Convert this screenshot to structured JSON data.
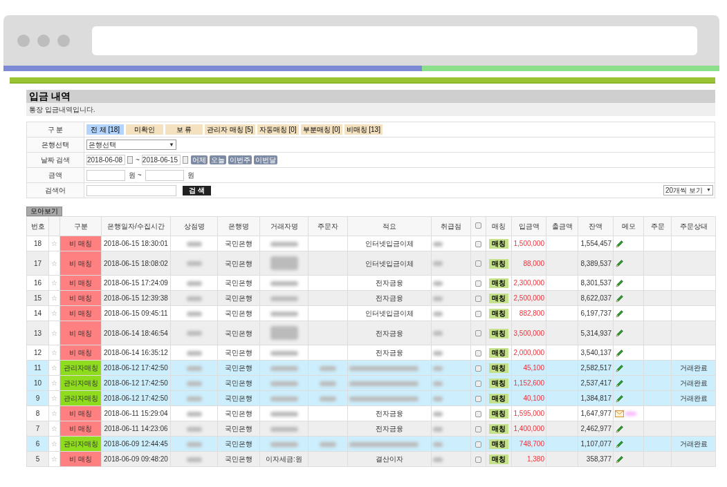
{
  "browser": {
    "progress": {
      "level": 0.585
    }
  },
  "page": {
    "title": "입금 내역",
    "subtitle": "통장 입금내역입니다."
  },
  "filters": {
    "category": {
      "label": "구 분",
      "tabs": [
        {
          "label": "전 체 [18]",
          "selected": true
        },
        {
          "label": "미확인",
          "selected": false
        },
        {
          "label": "보 류",
          "selected": false
        },
        {
          "label": "관리자 매칭 [5]",
          "selected": false
        },
        {
          "label": "자동매칭 [0]",
          "selected": false
        },
        {
          "label": "부분매칭 [0]",
          "selected": false
        },
        {
          "label": "비매칭 [13]",
          "selected": false
        }
      ]
    },
    "bank": {
      "label": "은행선택",
      "value": "은행선택",
      "arrow": "▼"
    },
    "date": {
      "label": "날짜 검색",
      "from": "2018-06-08",
      "to": "2018-06-15",
      "separator": "~",
      "quick": [
        "어제",
        "오늘",
        "이번주",
        "이번달"
      ]
    },
    "amount": {
      "label": "금액",
      "unit1": "원 ~",
      "unit2": "원"
    },
    "keyword": {
      "label": "검색어",
      "button": "검 색"
    },
    "page_size": {
      "value": "20개씩 보기",
      "arrow": "▼"
    }
  },
  "collect_button": "모아보기",
  "table": {
    "columns": [
      "번호",
      "",
      "구분",
      "은행일자/수집시간",
      "상점명",
      "은행명",
      "거래자명",
      "주문자",
      "적요",
      "취급점",
      "",
      "매칭",
      "입금액",
      "출금액",
      "잔액",
      "메모",
      "주문",
      "주문상태"
    ],
    "header_checkbox": {
      "checked": false
    },
    "rows": [
      {
        "no": "18",
        "star": "☆",
        "status": {
          "kind": "unmatched",
          "label": "비 매칭"
        },
        "time": "2018-06-15 18:30:01",
        "bank": "국민은행",
        "memo_text": "인터넷입금이체",
        "checked": false,
        "match": "매칭",
        "deposit": "1,500,000",
        "balance": "1,554,457",
        "memo_icon": {
          "kind": "pencil"
        },
        "tall": false,
        "blurred": {
          "store": true,
          "customer": true,
          "branch": true
        }
      },
      {
        "no": "17",
        "star": "☆",
        "status": {
          "kind": "unmatched",
          "label": "비 매칭"
        },
        "time": "2018-06-15 18:08:02",
        "bank": "국민은행",
        "memo_text": "인터넷입금이체",
        "checked": false,
        "match": "매칭",
        "deposit": "88,000",
        "balance": "8,389,537",
        "memo_icon": {
          "kind": "pencil"
        },
        "tall": true,
        "blurred": {
          "store": true,
          "customer": true,
          "branch": true
        }
      },
      {
        "no": "16",
        "star": "☆",
        "status": {
          "kind": "unmatched",
          "label": "비 매칭"
        },
        "time": "2018-06-15 17:24:09",
        "bank": "국민은행",
        "memo_text": "전자금융",
        "checked": false,
        "match": "매칭",
        "deposit": "2,300,000",
        "balance": "8,301,537",
        "memo_icon": {
          "kind": "pencil"
        },
        "tall": false,
        "blurred": {
          "store": true,
          "customer": true,
          "branch": true
        }
      },
      {
        "no": "15",
        "star": "☆",
        "status": {
          "kind": "unmatched",
          "label": "비 매칭"
        },
        "time": "2018-06-15 12:39:38",
        "bank": "국민은행",
        "memo_text": "전자금융",
        "checked": false,
        "match": "매칭",
        "deposit": "2,500,000",
        "balance": "8,622,037",
        "memo_icon": {
          "kind": "pencil"
        },
        "tall": false,
        "blurred": {
          "store": true,
          "customer": true,
          "branch": true
        }
      },
      {
        "no": "14",
        "star": "☆",
        "status": {
          "kind": "unmatched",
          "label": "비 매칭"
        },
        "time": "2018-06-15 09:45:11",
        "bank": "국민은행",
        "memo_text": "인터넷입금이체",
        "checked": false,
        "match": "매칭",
        "deposit": "882,800",
        "balance": "6,197,737",
        "memo_icon": {
          "kind": "pencil"
        },
        "tall": false,
        "blurred": {
          "store": true,
          "customer": true,
          "branch": true
        }
      },
      {
        "no": "13",
        "star": "☆",
        "status": {
          "kind": "unmatched",
          "label": "비 매칭"
        },
        "time": "2018-06-14 18:46:54",
        "bank": "국민은행",
        "memo_text": "전자금융",
        "checked": false,
        "match": "매칭",
        "deposit": "3,500,000",
        "balance": "5,314,937",
        "memo_icon": {
          "kind": "pencil"
        },
        "tall": true,
        "blurred": {
          "store": true,
          "customer": true,
          "branch": true
        }
      },
      {
        "no": "12",
        "star": "☆",
        "status": {
          "kind": "unmatched",
          "label": "비 매칭"
        },
        "time": "2018-06-14 16:35:12",
        "bank": "국민은행",
        "memo_text": "전자금융",
        "checked": false,
        "match": "매칭",
        "deposit": "2,000,000",
        "balance": "3,540,137",
        "memo_icon": {
          "kind": "pencil"
        },
        "tall": false,
        "blurred": {
          "store": true,
          "customer": true,
          "branch": true
        }
      },
      {
        "no": "11",
        "star": "☆",
        "status": {
          "kind": "admin",
          "label": "관리자매칭"
        },
        "time": "2018-06-12 17:42:50",
        "bank": "국민은행",
        "checked": false,
        "match": "매칭",
        "deposit": "45,100",
        "balance": "2,582,517",
        "memo_icon": {
          "kind": "pencil"
        },
        "order_status": "거래완료",
        "tall": false,
        "blurred": {
          "store": true,
          "customer": true,
          "orderer": true,
          "memo_text": true,
          "branch": true
        }
      },
      {
        "no": "10",
        "star": "☆",
        "status": {
          "kind": "admin",
          "label": "관리자매칭"
        },
        "time": "2018-06-12 17:42:50",
        "bank": "국민은행",
        "checked": false,
        "match": "매칭",
        "deposit": "1,152,600",
        "balance": "2,537,417",
        "memo_icon": {
          "kind": "pencil"
        },
        "order_status": "거래완료",
        "tall": false,
        "blurred": {
          "store": true,
          "customer": true,
          "orderer": true,
          "memo_text": true,
          "branch": true
        }
      },
      {
        "no": "9",
        "star": "☆",
        "status": {
          "kind": "admin",
          "label": "관리자매칭"
        },
        "time": "2018-06-12 17:42:50",
        "bank": "국민은행",
        "checked": false,
        "match": "매칭",
        "deposit": "40,100",
        "balance": "1,384,817",
        "memo_icon": {
          "kind": "pencil"
        },
        "order_status": "거래완료",
        "tall": false,
        "blurred": {
          "store": true,
          "customer": true,
          "orderer": true,
          "memo_text": true,
          "branch": true
        }
      },
      {
        "no": "8",
        "star": "☆",
        "status": {
          "kind": "unmatched",
          "label": "비 매칭"
        },
        "time": "2018-06-11 15:29:04",
        "bank": "국민은행",
        "memo_text": "전자금융",
        "checked": false,
        "match": "매칭",
        "deposit": "1,595,000",
        "balance": "1,647,977",
        "memo_icon": {
          "kind": "envelope"
        },
        "tall": false,
        "blurred": {
          "store": true,
          "customer": true,
          "branch": true
        }
      },
      {
        "no": "7",
        "star": "☆",
        "status": {
          "kind": "unmatched",
          "label": "비 매칭"
        },
        "time": "2018-06-11 14:23:06",
        "bank": "국민은행",
        "memo_text": "전자금융",
        "checked": false,
        "match": "매칭",
        "deposit": "1,400,000",
        "balance": "2,462,977",
        "memo_icon": {
          "kind": "pencil"
        },
        "tall": false,
        "blurred": {
          "store": true,
          "customer": true,
          "branch": true
        }
      },
      {
        "no": "6",
        "star": "☆",
        "status": {
          "kind": "admin",
          "label": "관리자매칭"
        },
        "time": "2018-06-09 12:44:45",
        "bank": "국민은행",
        "checked": false,
        "match": "매칭",
        "deposit": "748,700",
        "balance": "1,107,077",
        "memo_icon": {
          "kind": "pencil"
        },
        "order_status": "거래완료",
        "tall": false,
        "blurred": {
          "store": true,
          "customer": true,
          "orderer": true,
          "memo_text": true,
          "branch": true
        }
      },
      {
        "no": "5",
        "star": "☆",
        "status": {
          "kind": "unmatched",
          "label": "비 매칭"
        },
        "time": "2018-06-09 09:48:20",
        "bank": "국민은행",
        "customer": "이자세금:원",
        "memo_text": "결산이자",
        "checked": false,
        "match": "매칭",
        "deposit": "1,380",
        "balance": "358,377",
        "memo_icon": {
          "kind": "pencil"
        },
        "tall": false,
        "blurred": {
          "store": true,
          "branch": true
        }
      }
    ]
  }
}
